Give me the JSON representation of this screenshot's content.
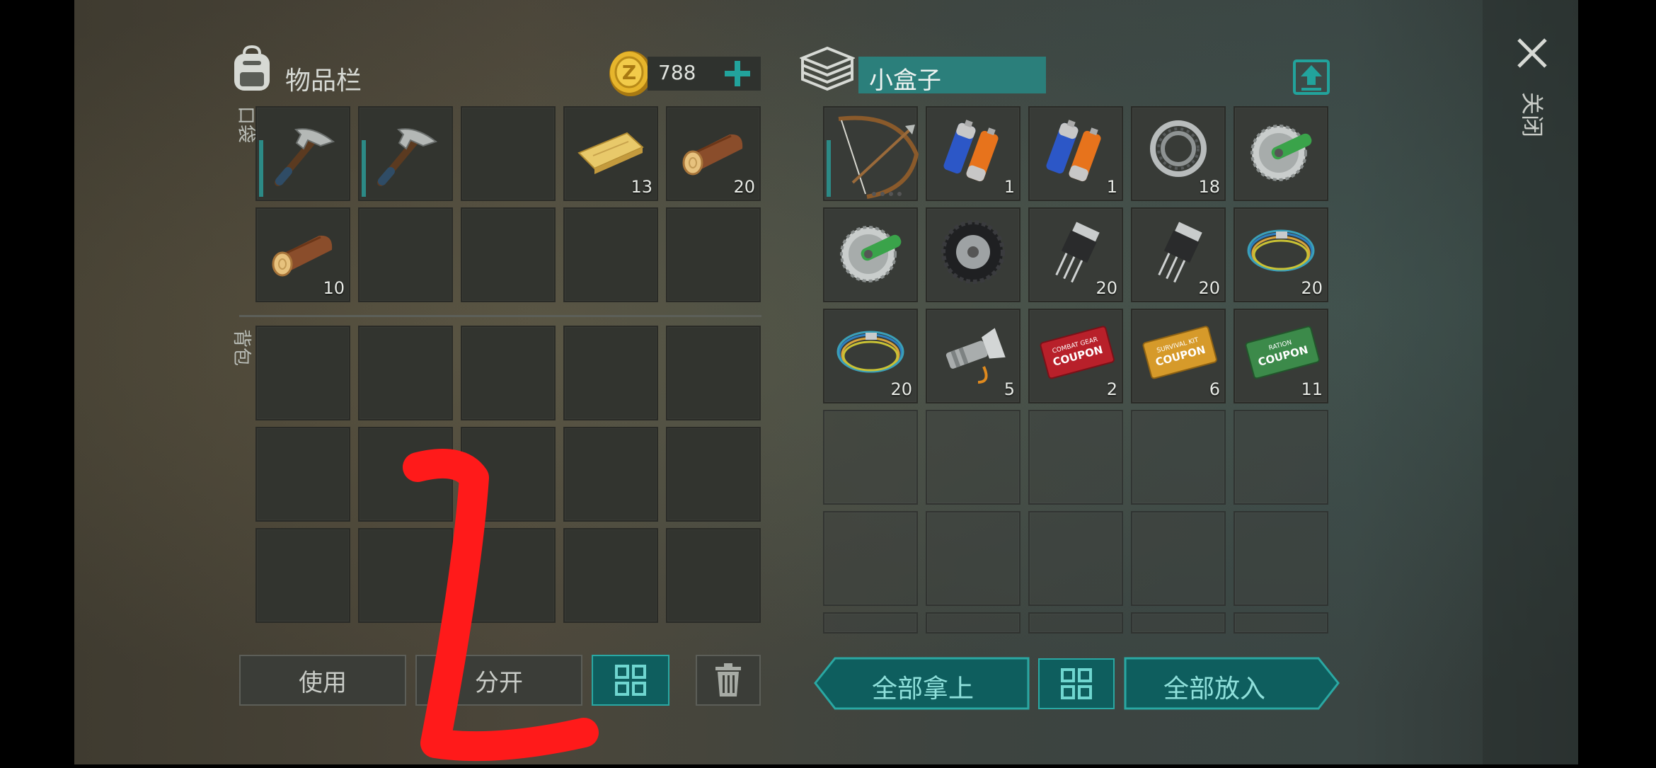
{
  "inventory": {
    "title": "物品栏",
    "coins": "788",
    "pocket_label": "口袋",
    "backpack_label": "背包",
    "pocket_slots": [
      {
        "icon": "pickaxe-icon",
        "qty": ""
      },
      {
        "icon": "pickaxe-icon",
        "qty": ""
      },
      {
        "icon": "empty",
        "qty": ""
      },
      {
        "icon": "wood-plank-icon",
        "qty": "13"
      },
      {
        "icon": "log-icon",
        "qty": "20"
      },
      {
        "icon": "log-icon",
        "qty": "10"
      },
      {
        "icon": "empty",
        "qty": ""
      },
      {
        "icon": "empty",
        "qty": ""
      },
      {
        "icon": "empty",
        "qty": ""
      },
      {
        "icon": "empty",
        "qty": ""
      }
    ],
    "buttons": {
      "use": "使用",
      "split": "分开"
    }
  },
  "container": {
    "title": "小盒子",
    "slots": [
      {
        "icon": "bow-icon",
        "qty": ""
      },
      {
        "icon": "battery-icon",
        "qty": "1"
      },
      {
        "icon": "battery-icon",
        "qty": "1"
      },
      {
        "icon": "bearing-icon",
        "qty": "18"
      },
      {
        "icon": "saw-blade-icon",
        "qty": ""
      },
      {
        "icon": "saw-blade-icon",
        "qty": ""
      },
      {
        "icon": "tire-icon",
        "qty": ""
      },
      {
        "icon": "transistor-icon",
        "qty": "20"
      },
      {
        "icon": "transistor-icon",
        "qty": "20"
      },
      {
        "icon": "wire-icon",
        "qty": "20"
      },
      {
        "icon": "wire-icon",
        "qty": "20"
      },
      {
        "icon": "flashlight-icon",
        "qty": "5"
      },
      {
        "icon": "combat-coupon-icon",
        "qty": "2"
      },
      {
        "icon": "survival-coupon-icon",
        "qty": "6"
      },
      {
        "icon": "ration-coupon-icon",
        "qty": "11"
      }
    ],
    "coupon_text": {
      "combat_top": "COMBAT GEAR",
      "survival_top": "SURVIVAL KIT",
      "ration_top": "RATION",
      "coupon": "COUPON"
    },
    "buttons": {
      "take_all": "全部拿上",
      "put_all": "全部放入"
    }
  },
  "close_label": "关闭",
  "colors": {
    "accent": "#2aa8a3",
    "teal_fill": "#0e5e5e",
    "annotation": "#ff1a1a"
  }
}
